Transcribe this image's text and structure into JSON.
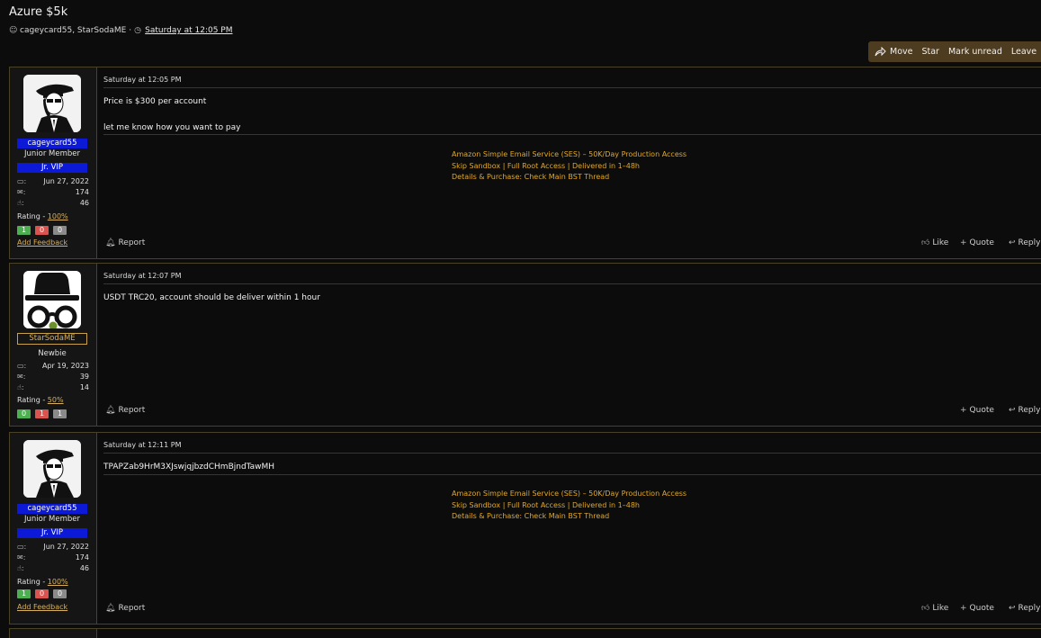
{
  "thread": {
    "title": "Azure $5k",
    "participants": "cageycard55, StarSodaME",
    "separator": "·",
    "date": "Saturday at 12:05 PM"
  },
  "toolbar": {
    "move": "Move",
    "star": "Star",
    "mark_unread": "Mark unread",
    "leave": "Leave"
  },
  "actions": {
    "report": "Report",
    "like": "Like",
    "quote": "Quote",
    "reply": "Reply"
  },
  "users": {
    "cageycard55": {
      "name": "cageycard55",
      "rank": "Junior Member",
      "badge": "Jr. VIP",
      "joined": "Jun 27, 2022",
      "messages": "174",
      "reactions": "46",
      "rating_label": "Rating -",
      "rating": "100%",
      "fb_pos": "1",
      "fb_neg": "0",
      "fb_neu": "0",
      "add_feedback": "Add Feedback"
    },
    "starsoda": {
      "name": "StarSodaME",
      "rank": "Newbie",
      "joined": "Apr 19, 2023",
      "messages": "39",
      "reactions": "14",
      "rating_label": "Rating -",
      "rating": "50%",
      "fb_pos": "0",
      "fb_neg": "1",
      "fb_neu": "1"
    }
  },
  "signature": {
    "line1": "Amazon Simple Email Service (SES) – 50K/Day Production Access",
    "line2": "Skip Sandbox | Full Root Access | Delivered in 1–48h",
    "line3": "Details & Purchase: Check Main BST Thread"
  },
  "posts": [
    {
      "date": "Saturday at 12:05 PM",
      "line1": "Price is $300 per account",
      "line2": "let me know how you want to pay"
    },
    {
      "date": "Saturday at 12:07 PM",
      "line1": "USDT TRC20, account should be deliver within 1 hour"
    },
    {
      "date": "Saturday at 12:11 PM",
      "line1": "TPAPZab9HrM3XJswjqjbzdCHmBjndTawMH"
    }
  ],
  "colors": {
    "accent": "#d9b05a",
    "signature": "#e2a928",
    "vip_blue": "#0c1ad8",
    "toolbar_bg": "#4d3c20",
    "border": "#4a4228"
  }
}
